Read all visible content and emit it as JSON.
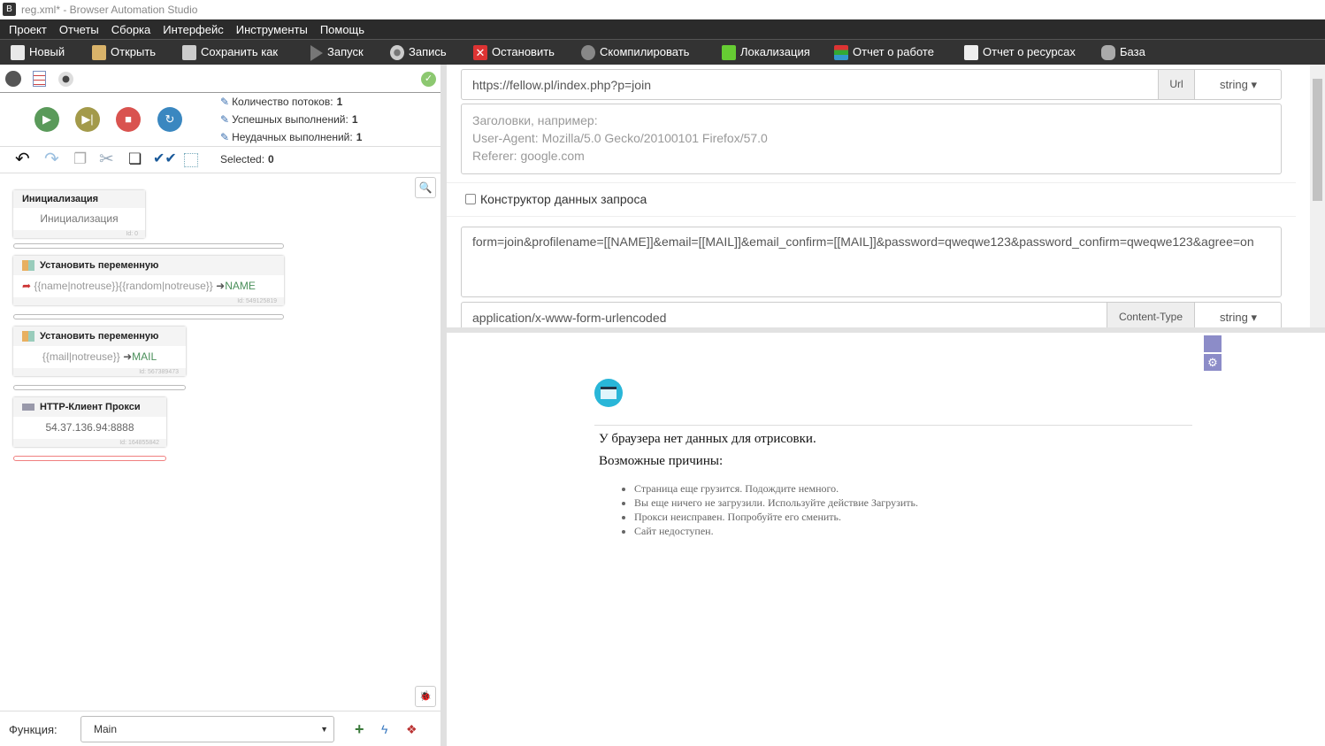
{
  "window": {
    "title": "reg.xml* - Browser Automation Studio",
    "logo": "B"
  },
  "menu": [
    "Проект",
    "Отчеты",
    "Сборка",
    "Интерфейс",
    "Инструменты",
    "Помощь"
  ],
  "toolbar": [
    {
      "label": "Новый",
      "icon": "new-file-icon",
      "color": "#e8e8e8"
    },
    {
      "label": "Открыть",
      "icon": "open-folder-icon",
      "color": "#d9b36a"
    },
    {
      "label": "Сохранить как",
      "icon": "save-as-icon",
      "color": "#ddd"
    },
    {
      "label": "Запуск",
      "icon": "play-icon",
      "color": "#777"
    },
    {
      "label": "Запись",
      "icon": "record-icon",
      "color": "#bbb"
    },
    {
      "label": "Остановить",
      "icon": "stop-x-icon",
      "color": "#d33"
    },
    {
      "label": "Скомпилировать",
      "icon": "compile-icon",
      "color": "#888"
    },
    {
      "label": "Локализация",
      "icon": "localization-icon",
      "color": "#6c3"
    },
    {
      "label": "Отчет о работе",
      "icon": "work-report-icon",
      "color": "#39c"
    },
    {
      "label": "Отчет о ресурсах",
      "icon": "resource-report-icon",
      "color": "#eee"
    },
    {
      "label": "База",
      "icon": "database-icon",
      "color": "#aaa"
    }
  ],
  "stats": {
    "threads_label": "Количество потоков:",
    "threads": "1",
    "success_label": "Успешных выполнений:",
    "success": "1",
    "fail_label": "Неудачных выполнений:",
    "fail": "1",
    "selected_label": "Selected:",
    "selected": "0"
  },
  "colors": {
    "play": "#5a9a5a",
    "step": "#a39a4a",
    "stop": "#d9534f",
    "restart": "#3a87c0"
  },
  "actions": [
    {
      "title": "Инициализация",
      "body": "Инициализация",
      "id": "Id: 0"
    },
    {
      "title": "Установить переменную",
      "value": "{{name|notreuse}}{{random|notreuse}}",
      "var": "NAME",
      "id": "Id: 549125819"
    },
    {
      "title": "Установить переменную",
      "value": "{{mail|notreuse}}",
      "var": "MAIL",
      "id": "Id: 567389473"
    },
    {
      "title": "HTTP-Клиент Прокси",
      "body": "54.37.136.94:8888",
      "id": "Id: 164855842"
    }
  ],
  "function": {
    "label": "Функция:",
    "value": "Main"
  },
  "form": {
    "url": "https://fellow.pl/index.php?p=join",
    "url_addon": "Url",
    "type1": "string",
    "headers_placeholder": "Заголовки, например:\nUser-Agent: Mozilla/5.0 Gecko/20100101 Firefox/57.0\nReferer: google.com",
    "constructor_label": "Конструктор данных запроса",
    "post_data": "form=join&profilename=[[NAME]]&email=[[MAIL]]&email_confirm=[[MAIL]]&password=qweqwe123&password_confirm=qweqwe123&agree=on",
    "content_type": "application/x-www-form-urlencoded",
    "ct_addon": "Content-Type",
    "type2": "string"
  },
  "browser": {
    "message": "У браузера нет данных для отрисовки.",
    "reasons_title": "Возможные причины:",
    "reasons": [
      "Страница еще грузится. Подождите немного.",
      "Вы еще ничего не загрузили. Используйте действие Загрузить.",
      "Прокси неисправен. Попробуйте его сменить.",
      "Сайт недоступен."
    ]
  }
}
